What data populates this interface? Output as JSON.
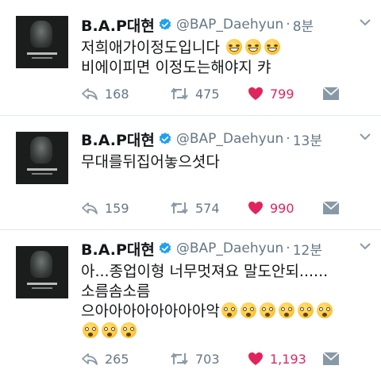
{
  "tweets": [
    {
      "name": "B.A.P대현",
      "handle": "@BAP_Daehyun",
      "dot": "·",
      "time": "8분",
      "text": "저희애가이정도입니다",
      "text_emojis": [
        "grinning-sweat-face",
        "grinning-sweat-face",
        "grinning-sweat-face"
      ],
      "text_line2": "비에이피면 이정도는해야지 캬",
      "replies": "168",
      "retweets": "475",
      "likes": "799"
    },
    {
      "name": "B.A.P대현",
      "handle": "@BAP_Daehyun",
      "dot": "·",
      "time": "13분",
      "text": "무대를뒤집어놓으셧다",
      "replies": "159",
      "retweets": "574",
      "likes": "990"
    },
    {
      "name": "B.A.P대현",
      "handle": "@BAP_Daehyun",
      "dot": "·",
      "time": "12분",
      "text": "아...종업이형 너무멋져요 말도안되......",
      "text_line2": "소름솜소름",
      "text_line3": "으아아아아아아아아악",
      "text_emojis": [
        "astonished-face",
        "astonished-face",
        "astonished-face",
        "astonished-face",
        "astonished-face",
        "astonished-face",
        "astonished-face",
        "astonished-face",
        "astonished-face"
      ],
      "replies": "265",
      "retweets": "703",
      "likes": "1,193"
    }
  ],
  "colors": {
    "accent": "#1da1f2",
    "like": "#e0245e",
    "muted": "#657786",
    "text": "#14171a"
  },
  "icons": [
    "reply-icon",
    "retweet-icon",
    "heart-icon",
    "direct-message-icon",
    "verified-badge-icon",
    "chevron-down-icon"
  ]
}
